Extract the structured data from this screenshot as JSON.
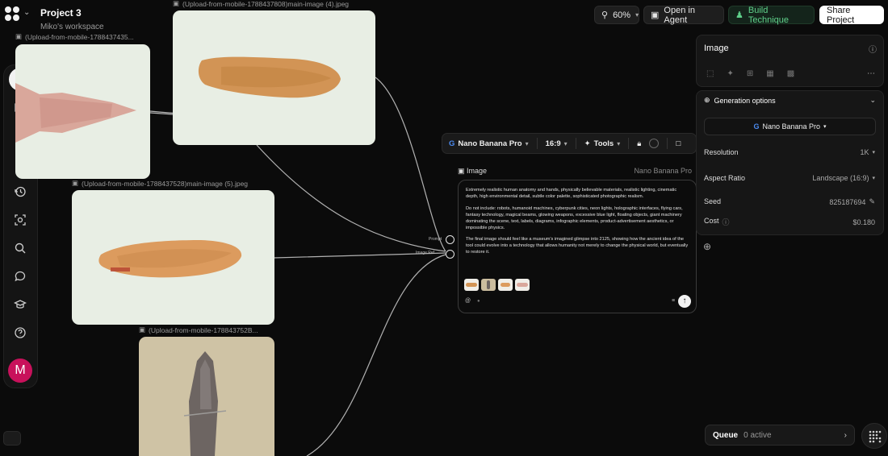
{
  "header": {
    "project_title": "Project 3",
    "workspace": "Miko's workspace"
  },
  "toolbar": {
    "zoom": "60%",
    "open_agent": "Open in Agent",
    "build_technique": "Build Technique",
    "share": "Share Project"
  },
  "nodes": {
    "n1_label": "(Upload-from-mobile-1788437435...",
    "n2_label": "(Upload-from-mobile-1788437808)main-image (4).jpeg",
    "n3_label": "(Upload-from-mobile-1788437528)main-image (5).jpeg",
    "n4_label": "(Upload-from-mobile-178843752B..."
  },
  "model_bar": {
    "model": "Nano Banana Pro",
    "ratio": "16:9",
    "tools": "Tools"
  },
  "gen_node": {
    "title": "Image",
    "model": "Nano Banana Pro",
    "prompt_p1": "Extremely realistic human anatomy and hands, physically believable materials, realistic lighting, cinematic depth, high environmental detail, subtle color palette, sophisticated photographic realism.",
    "prompt_p2": "Do not include: robots, humanoid machines, cyberpunk cities, neon lights, holographic interfaces, flying cars, fantasy technology, magical beams, glowing weapons, excessive blue light, floating objects, giant machinery dominating the scene, text, labels, diagrams, infographic elements, product-advertisement aesthetics, or impossible physics.",
    "prompt_p3": "The final image should feel like a museum's imagined glimpse into 2125, showing how the ancient idea of the tool could evolve into a technology that allows humanity not merely to change the physical world, but eventually to restore it.",
    "port_prompt": "Prompt",
    "port_image": "Image Ref"
  },
  "image_panel": {
    "title": "Image"
  },
  "gen_options": {
    "title": "Generation options",
    "model": "Nano Banana Pro",
    "resolution_label": "Resolution",
    "resolution_value": "1K",
    "aspect_label": "Aspect Ratio",
    "aspect_value": "Landscape (16:9)",
    "seed_label": "Seed",
    "seed_value": "825187694",
    "cost_label": "Cost",
    "cost_value": "$0.180"
  },
  "queue": {
    "label": "Queue",
    "status": "0 active"
  },
  "avatar_letter": "M",
  "colors": {
    "accent_green": "#5fd08a",
    "avatar": "#c8115b",
    "background": "#0b0b0b"
  }
}
